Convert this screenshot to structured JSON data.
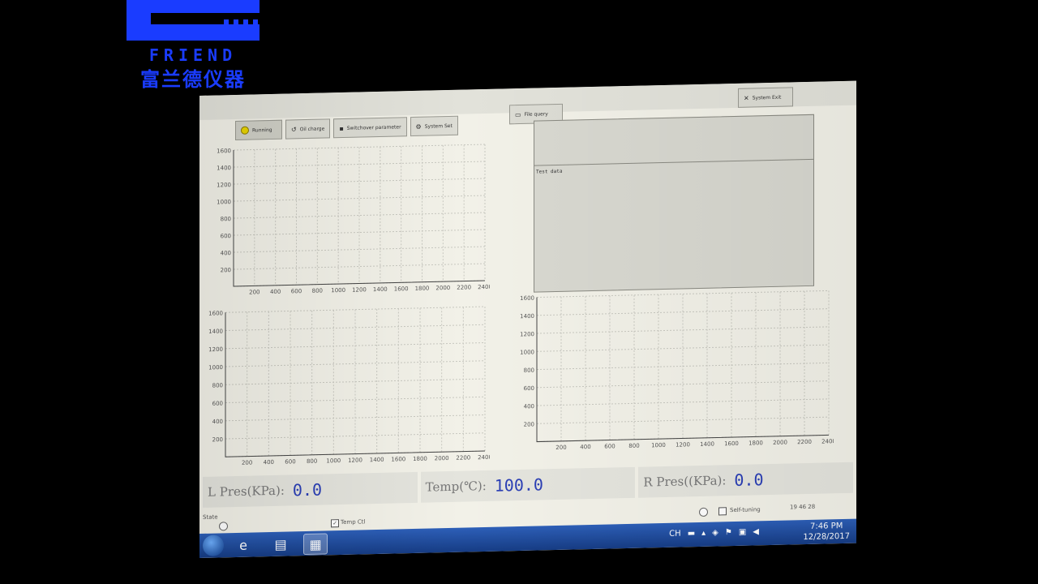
{
  "logo": {
    "english": "FRIEND",
    "chinese": "富兰德仪器"
  },
  "toolbar": {
    "run_label": "Running",
    "curve_label": "Oil charge",
    "param_label": "Switchover parameter",
    "settings_label": "System Set",
    "file_label": "File query",
    "exit_label": "System Exit"
  },
  "data_panel": {
    "label": "Test data"
  },
  "charts": [
    {
      "id": "top-left",
      "y_ticks": [
        "1600",
        "1400",
        "1200",
        "1000",
        "800",
        "600",
        "400",
        "200"
      ],
      "x_ticks": [
        "200",
        "400",
        "600",
        "800",
        "1000",
        "1200",
        "1400",
        "1600",
        "1800",
        "2000",
        "2200",
        "2400"
      ]
    },
    {
      "id": "bottom-left",
      "y_ticks": [
        "1600",
        "1400",
        "1200",
        "1000",
        "800",
        "600",
        "400",
        "200"
      ],
      "x_ticks": [
        "200",
        "400",
        "600",
        "800",
        "1000",
        "1200",
        "1400",
        "1600",
        "1800",
        "2000",
        "2200",
        "2400"
      ]
    },
    {
      "id": "bottom-right",
      "y_ticks": [
        "1600",
        "1400",
        "1200",
        "1000",
        "800",
        "600",
        "400",
        "200"
      ],
      "x_ticks": [
        "200",
        "400",
        "600",
        "800",
        "1000",
        "1200",
        "1400",
        "1600",
        "1800",
        "2000",
        "2200",
        "2400"
      ]
    }
  ],
  "readouts": {
    "l_pres": {
      "label": "L Pres(KPa):",
      "value": "0.0"
    },
    "temp": {
      "label": "Temp(℃):",
      "value": "100.0"
    },
    "r_pres": {
      "label": "R Pres((KPa):",
      "value": "0.0"
    }
  },
  "status": {
    "state_label": "State",
    "temp_ctl_label": "Temp Ctl",
    "temp_ctl_checked": true,
    "self_tuning_label": "Self-tuning",
    "self_tuning_checked": false,
    "time": "19 46 28"
  },
  "taskbar": {
    "clock_time": "7:46 PM",
    "clock_date": "12/28/2017",
    "lang": "CH"
  },
  "colors": {
    "grid": "#c8c8c0",
    "value": "#2b3fb5",
    "taskbar": "#1e4a9e"
  }
}
